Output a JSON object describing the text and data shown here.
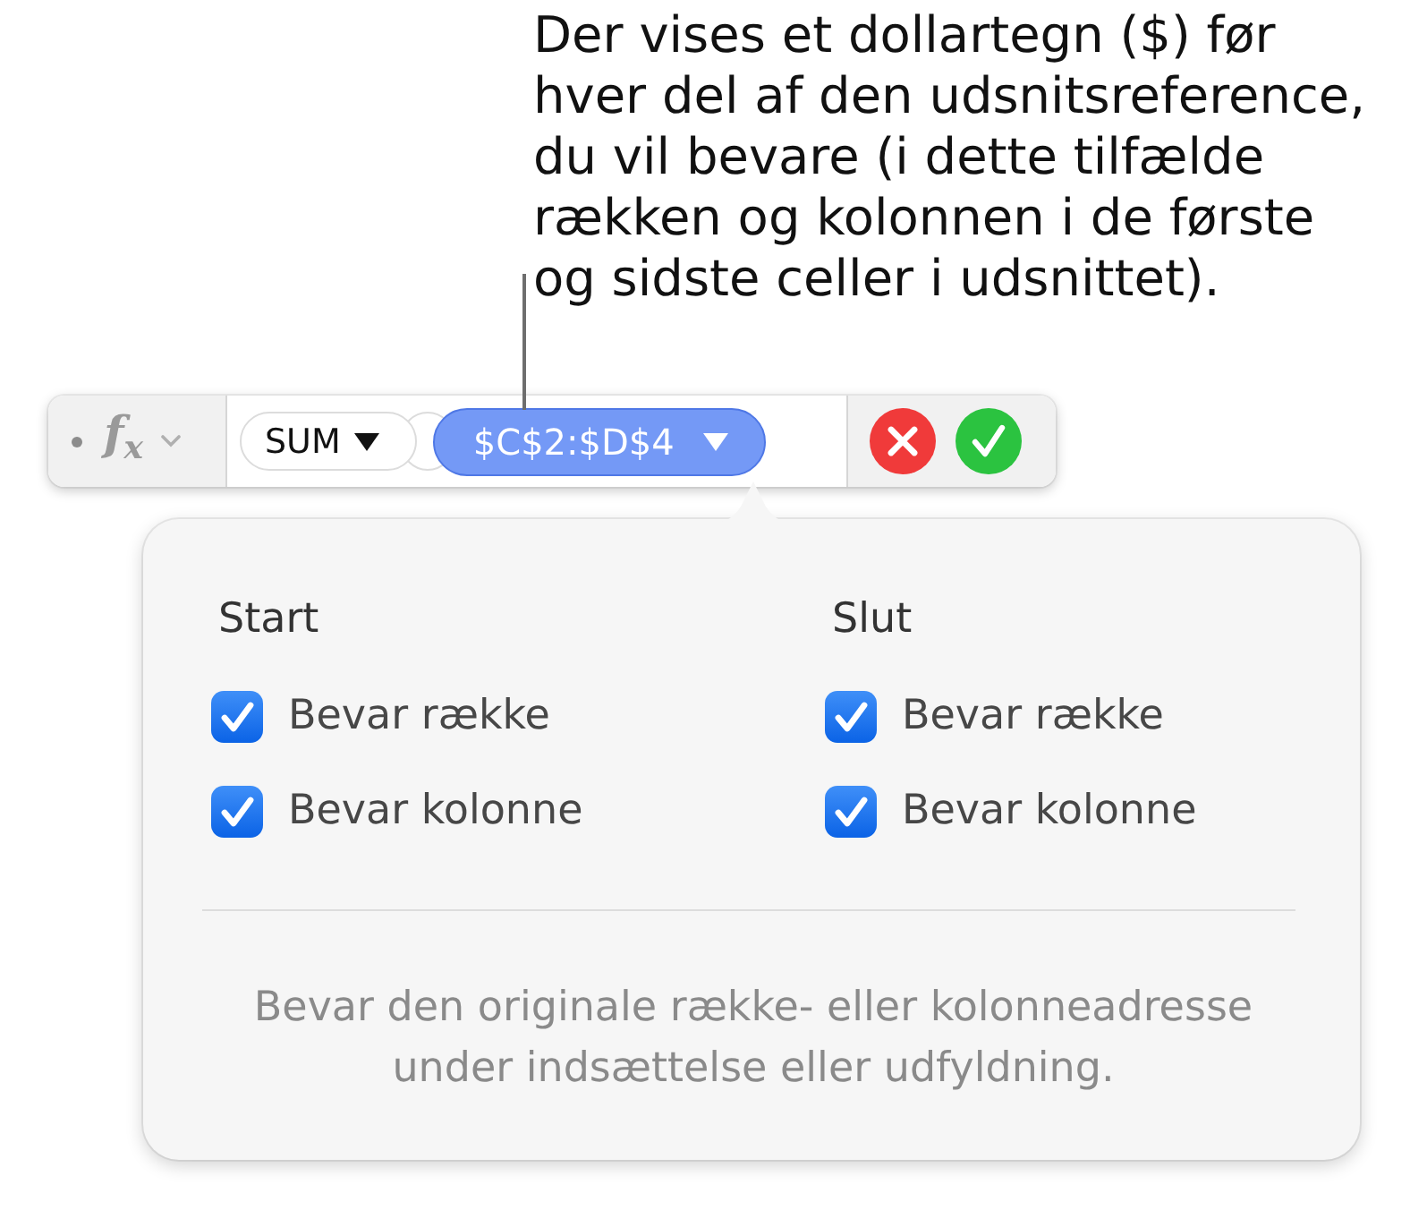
{
  "callout": {
    "text": "Der vises et dollartegn ($) før hver del af den udsnitsreference, du vil bevare (i dette tilfælde rækken og kolonnen i de første og sidste celler i udsnittet)."
  },
  "formula_bar": {
    "formula_button": {
      "label": "f$_{x}$"
    },
    "tokens": [
      {
        "label": "SUM",
        "selected": false
      },
      {
        "label": "$C$2:$D$4",
        "selected": true
      }
    ]
  },
  "popover": {
    "columns": [
      {
        "heading": "Start",
        "options": [
          {
            "label": "Bevar række",
            "checked": true
          },
          {
            "label": "Bevar kolonne",
            "checked": true
          }
        ]
      },
      {
        "heading": "Slut",
        "options": [
          {
            "label": "Bevar række",
            "checked": true
          },
          {
            "label": "Bevar kolonne",
            "checked": true
          }
        ]
      }
    ],
    "description": "Bevar den originale række- eller kolonneadresse under indsættelse eller udfyldning."
  }
}
